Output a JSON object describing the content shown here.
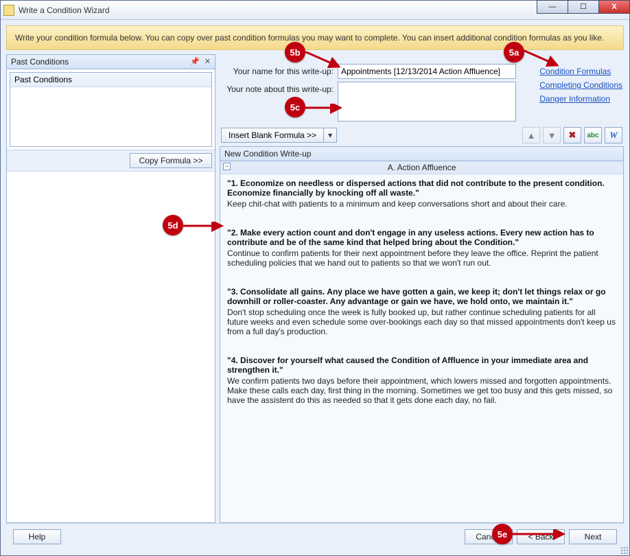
{
  "window": {
    "title": "Write a Condition Wizard"
  },
  "banner": "Write your condition formula below. You can copy over past condition formulas you may want to complete. You can insert additional condition formulas as you like.",
  "past": {
    "panel_title": "Past Conditions",
    "sub_title": "Past Conditions",
    "copy_btn": "Copy Formula >>"
  },
  "form": {
    "name_label": "Your name for this write-up:",
    "name_value": "Appointments [12/13/2014 Action Affluence]",
    "note_label": "Your note about this write-up:",
    "note_value": ""
  },
  "links": {
    "formulas": "Condition Formulas",
    "completing": "Completing Conditions",
    "danger": "Danger Information"
  },
  "toolbar": {
    "insert_btn": "Insert Blank Formula >>"
  },
  "writeup": {
    "header": "New Condition Write-up",
    "section": "A. Action Affluence",
    "steps": [
      {
        "title": "\"1. Economize on needless or dispersed actions that did not contribute to the present condition. Economize financially by knocking off all waste.\"",
        "desc": "Keep chit-chat with patients to a minimum and keep conversations short and about their care."
      },
      {
        "title": "\"2. Make every action count and don't engage in any useless actions. Every new action has to contribute and be of the same kind that helped bring about the Condition.\"",
        "desc": "Continue to confirm patients for their next appointment before they leave the office. Reprint the patient scheduling policies that we hand out to patients so that we won't run out."
      },
      {
        "title": "\"3. Consolidate all gains. Any place we have gotten a gain, we keep it; don't let things relax or go downhill or roller-coaster. Any advantage or gain we have, we hold onto, we maintain it.\"",
        "desc": "Don't stop scheduling once the week is fully booked up, but rather continue scheduling patients for all future weeks and even schedule some over-bookings each day so that missed appointments don't keep us from a full day's production."
      },
      {
        "title": "\"4. Discover for yourself what caused the Condition of Affluence in your immediate area and strengthen it.\"",
        "desc": "We confirm patients two days before their appointment, which lowers missed and forgotten appointments. Make these calls each day, first thing in the morning. Sometimes we get too busy and this gets missed, so have the assistent do this as needed so that it gets done each day, no fail."
      }
    ]
  },
  "footer": {
    "help": "Help",
    "cancel": "Cancel",
    "back": "< Back",
    "next": "Next"
  },
  "callouts": {
    "a": "5a",
    "b": "5b",
    "c": "5c",
    "d": "5d",
    "e": "5e"
  }
}
